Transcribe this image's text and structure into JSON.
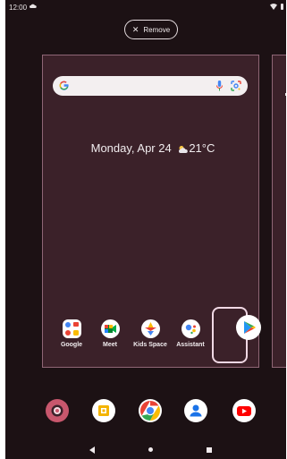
{
  "status_bar": {
    "time": "12:00"
  },
  "edit_mode": {
    "remove_label": "Remove"
  },
  "home": {
    "date_weather": "Monday, Apr 24",
    "temperature": "21°C"
  },
  "page_apps": [
    {
      "label": "Google",
      "icon": "google-folder-icon"
    },
    {
      "label": "Meet",
      "icon": "meet-icon"
    },
    {
      "label": "Kids Space",
      "icon": "kids-space-icon"
    },
    {
      "label": "Assistant",
      "icon": "assistant-icon"
    }
  ],
  "dragged_app": {
    "icon": "play-store-icon"
  },
  "dock_apps": [
    {
      "icon": "settings-icon"
    },
    {
      "icon": "slides-icon"
    },
    {
      "icon": "chrome-icon"
    },
    {
      "icon": "contacts-icon"
    },
    {
      "icon": "youtube-icon"
    }
  ],
  "colors": {
    "background": "#1c1114",
    "card": "#3b2129",
    "card_border": "#8f6676",
    "text": "#f1ecee"
  }
}
